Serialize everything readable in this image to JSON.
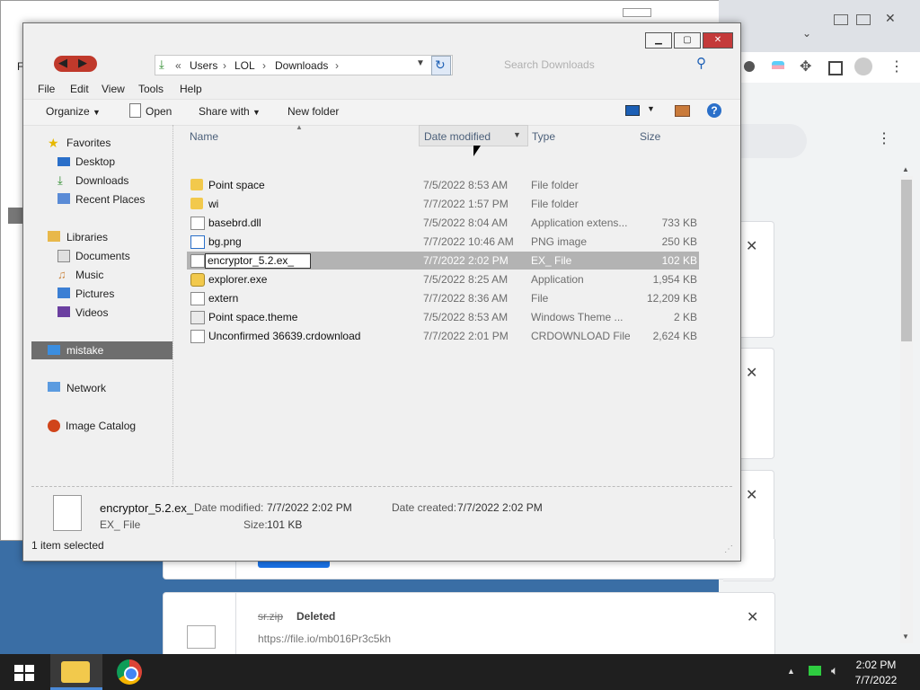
{
  "chrome": {
    "download_file": "sr.zip",
    "download_status": "Deleted",
    "download_url": "https://file.io/mb016Pr3c5kh"
  },
  "explorer": {
    "address": {
      "sep": "«",
      "crumbs": [
        "Users",
        "LOL",
        "Downloads"
      ]
    },
    "search_placeholder": "Search Downloads",
    "menu": [
      "File",
      "Edit",
      "View",
      "Tools",
      "Help"
    ],
    "toolbar": {
      "organize": "Organize",
      "open": "Open",
      "share_with": "Share with",
      "new_folder": "New folder"
    },
    "nav": {
      "favorites": "Favorites",
      "favorites_items": [
        "Desktop",
        "Downloads",
        "Recent Places"
      ],
      "libraries": "Libraries",
      "libraries_items": [
        "Documents",
        "Music",
        "Pictures",
        "Videos"
      ],
      "computer": "mistake",
      "network": "Network",
      "image_catalog": "Image Catalog"
    },
    "columns": {
      "name": "Name",
      "date": "Date modified",
      "type": "Type",
      "size": "Size"
    },
    "files": [
      {
        "name": "Point space",
        "date": "7/5/2022 8:53 AM",
        "type": "File folder",
        "size": "",
        "icon": "folder-icon"
      },
      {
        "name": "wi",
        "date": "7/7/2022 1:57 PM",
        "type": "File folder",
        "size": "",
        "icon": "folder-icon"
      },
      {
        "name": "basebrd.dll",
        "date": "7/5/2022 8:04 AM",
        "type": "Application extens...",
        "size": "733 KB",
        "icon": "dll-file-icon"
      },
      {
        "name": "bg.png",
        "date": "7/7/2022 10:46 AM",
        "type": "PNG image",
        "size": "250 KB",
        "icon": "image-file-icon"
      },
      {
        "name": "encryptor_5.2.ex_",
        "date": "7/7/2022 2:02 PM",
        "type": "EX_ File",
        "size": "102 KB",
        "icon": "file-icon",
        "selected": true
      },
      {
        "name": "explorer.exe",
        "date": "7/5/2022 8:25 AM",
        "type": "Application",
        "size": "1,954 KB",
        "icon": "explorer-exe-icon"
      },
      {
        "name": "extern",
        "date": "7/7/2022 8:36 AM",
        "type": "File",
        "size": "12,209 KB",
        "icon": "file-icon"
      },
      {
        "name": "Point space.theme",
        "date": "7/5/2022 8:53 AM",
        "type": "Windows Theme ...",
        "size": "2 KB",
        "icon": "theme-file-icon"
      },
      {
        "name": "Unconfirmed 36639.crdownload",
        "date": "7/7/2022 2:01 PM",
        "type": "CRDOWNLOAD File",
        "size": "2,624 KB",
        "icon": "file-icon"
      }
    ],
    "details": {
      "name": "encryptor_5.2.ex_",
      "type": "EX_ File",
      "date_modified_label": "Date modified:",
      "date_modified": "7/7/2022 2:02 PM",
      "date_created_label": "Date created:",
      "date_created": "7/7/2022 2:02 PM",
      "size_label": "Size:",
      "size": "101 KB"
    },
    "status": "1 item selected"
  },
  "taskbar": {
    "time": "2:02 PM",
    "date": "7/7/2022"
  }
}
